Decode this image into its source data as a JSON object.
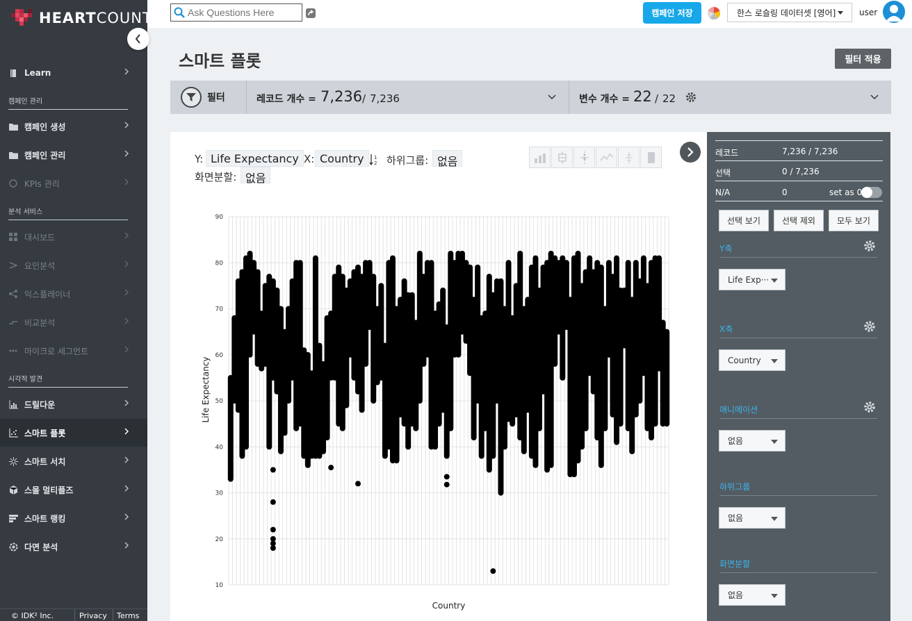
{
  "sidebar": {
    "logo_text_bold": "HEART",
    "logo_text_light": "COUNT",
    "items": [
      {
        "label": "Learn",
        "icon": "book-icon"
      },
      {
        "label": "캠페인 생성",
        "icon": "folder-add-icon"
      },
      {
        "label": "캠페인 관리",
        "icon": "folder-manage-icon"
      },
      {
        "label": "KPIs 관리",
        "icon": "kpi-icon"
      },
      {
        "label": "대시보드",
        "icon": "dashboard-icon"
      },
      {
        "label": "요인분석",
        "icon": "factor-icon"
      },
      {
        "label": "익스플레이너",
        "icon": "share-nodes-icon"
      },
      {
        "label": "비교분석",
        "icon": "compare-icon"
      },
      {
        "label": "마이크로 세그먼트",
        "icon": "segment-icon"
      },
      {
        "label": "드릴다운",
        "icon": "bar-chart-icon"
      },
      {
        "label": "스마트 플롯",
        "icon": "scatter-icon"
      },
      {
        "label": "스마트 서치",
        "icon": "sparkle-icon"
      },
      {
        "label": "스몰 멀티플즈",
        "icon": "cube-icon"
      },
      {
        "label": "스마트 랭킹",
        "icon": "ranking-icon"
      },
      {
        "label": "다면 분석",
        "icon": "gear-icon"
      }
    ],
    "sections": [
      "캠페인 관리",
      "분석 서비스",
      "시각적 발견"
    ],
    "footer": {
      "copyright": "© IDK² Inc.",
      "privacy": "Privacy",
      "terms": "Terms"
    }
  },
  "topbar": {
    "search_placeholder": "Ask Questions Here",
    "save_campaign": "캠페인 저장",
    "dataset": "한스 로슬링 데이터셋 [영어]",
    "user": "user"
  },
  "page": {
    "title": "스마트 플롯",
    "apply_filter": "필터 적용"
  },
  "filterbar": {
    "filter_label": "필터",
    "records_label": "레코드 개수 =",
    "records_value": "7,236",
    "records_total": "7,236",
    "vars_label": "변수 개수 =",
    "vars_value": "22",
    "vars_total": "22"
  },
  "encoding": {
    "y_label": "Y:",
    "y_value": "Life Expectancy",
    "x_label": "X:",
    "x_value": "Country",
    "sort_icon": "sort-ascending-icon",
    "subgroup_label": "하위그룹:",
    "subgroup_value": "없음",
    "split_label": "화면분할:",
    "split_value": "없음"
  },
  "right_panel": {
    "record_label": "레코드",
    "record_value": "7,236 / 7,236",
    "select_label": "선택",
    "select_value": "0 / 7,236",
    "na_label": "N/A",
    "na_value": "0",
    "set_as_zero": "set as 0",
    "btn_view_selected": "선택 보기",
    "btn_exclude_selected": "선택 제외",
    "btn_view_all": "모두 보기",
    "y_axis_head": "Y축",
    "y_axis_value": "Life Exp···",
    "x_axis_head": "X축",
    "x_axis_value": "Country",
    "animation_head": "애니메이션",
    "animation_value": "없음",
    "subgroup_head": "하위그룹",
    "subgroup_value": "없음",
    "split_head": "화면분할",
    "split_value": "없음"
  },
  "colors": {
    "accent": "#16a8e8",
    "sidebar": "#353b40",
    "panel": "#535c63",
    "head": "#3cb4ea"
  },
  "chart_data": {
    "type": "scatter",
    "xlabel": "Country",
    "ylabel": "Life Expectancy",
    "ylim": [
      10,
      90
    ],
    "yticks": [
      10,
      20,
      30,
      40,
      50,
      60,
      70,
      80,
      90
    ],
    "grid": true,
    "x_category_count": 114,
    "note_ranges": "each country column spans min-max life expectancy across years",
    "ranges": [
      [
        33,
        55
      ],
      [
        50,
        68
      ],
      [
        48,
        76
      ],
      [
        38,
        78
      ],
      [
        40,
        81
      ],
      [
        60,
        82
      ],
      [
        65,
        80
      ],
      [
        58,
        78
      ],
      [
        57,
        69
      ],
      [
        58,
        75
      ],
      [
        40,
        77
      ],
      [
        55,
        76
      ],
      [
        52,
        74
      ],
      [
        39,
        70
      ],
      [
        43,
        65
      ],
      [
        50,
        70
      ],
      [
        55,
        76
      ],
      [
        44,
        80
      ],
      [
        45,
        80
      ],
      [
        38,
        61
      ],
      [
        36,
        60
      ],
      [
        38,
        56
      ],
      [
        38,
        81
      ],
      [
        38,
        62
      ],
      [
        39,
        58
      ],
      [
        42,
        68
      ],
      [
        55,
        69
      ],
      [
        55,
        77
      ],
      [
        45,
        79
      ],
      [
        44,
        77
      ],
      [
        49,
        74
      ],
      [
        60,
        76
      ],
      [
        55,
        78
      ],
      [
        52,
        79
      ],
      [
        48,
        77
      ],
      [
        58,
        80
      ],
      [
        66,
        80
      ],
      [
        50,
        77
      ],
      [
        54,
        70
      ],
      [
        55,
        75
      ],
      [
        38,
        62
      ],
      [
        40,
        80
      ],
      [
        37,
        81
      ],
      [
        37,
        70
      ],
      [
        47,
        72
      ],
      [
        45,
        76
      ],
      [
        40,
        73
      ],
      [
        45,
        73
      ],
      [
        44,
        67
      ],
      [
        50,
        82
      ],
      [
        58,
        77
      ],
      [
        60,
        80
      ],
      [
        40,
        80
      ],
      [
        40,
        69
      ],
      [
        45,
        71
      ],
      [
        48,
        74
      ],
      [
        38,
        66
      ],
      [
        44,
        82
      ],
      [
        60,
        80
      ],
      [
        60,
        82
      ],
      [
        65,
        82
      ],
      [
        63,
        80
      ],
      [
        56,
        79
      ],
      [
        42,
        72
      ],
      [
        50,
        79
      ],
      [
        38,
        68
      ],
      [
        44,
        69
      ],
      [
        35,
        77
      ],
      [
        38,
        73
      ],
      [
        50,
        76
      ],
      [
        30,
        76
      ],
      [
        40,
        70
      ],
      [
        46,
        80
      ],
      [
        45,
        68
      ],
      [
        47,
        75
      ],
      [
        42,
        82
      ],
      [
        39,
        70
      ],
      [
        48,
        72
      ],
      [
        38,
        79
      ],
      [
        36,
        81
      ],
      [
        44,
        74
      ],
      [
        52,
        79
      ],
      [
        35,
        80
      ],
      [
        36,
        82
      ],
      [
        58,
        81
      ],
      [
        65,
        80
      ],
      [
        55,
        81
      ],
      [
        66,
        80
      ],
      [
        34,
        72
      ],
      [
        34,
        81
      ],
      [
        37,
        82
      ],
      [
        40,
        75
      ],
      [
        44,
        78
      ],
      [
        56,
        81
      ],
      [
        52,
        78
      ],
      [
        42,
        80
      ],
      [
        36,
        79
      ],
      [
        44,
        70
      ],
      [
        60,
        80
      ],
      [
        47,
        77
      ],
      [
        41,
        81
      ],
      [
        45,
        74
      ],
      [
        62,
        74
      ],
      [
        44,
        80
      ],
      [
        39,
        72
      ],
      [
        47,
        80
      ],
      [
        50,
        76
      ],
      [
        56,
        81
      ],
      [
        44,
        75
      ],
      [
        42,
        80
      ],
      [
        45,
        81
      ],
      [
        57,
        81
      ],
      [
        45,
        67
      ],
      [
        45,
        65
      ]
    ],
    "outliers": [
      {
        "x_index": 11,
        "y": 28
      },
      {
        "x_index": 11,
        "y": 22
      },
      {
        "x_index": 11,
        "y": 20
      },
      {
        "x_index": 11,
        "y": 19
      },
      {
        "x_index": 11,
        "y": 18
      },
      {
        "x_index": 11,
        "y": 35
      },
      {
        "x_index": 26,
        "y": 35.5
      },
      {
        "x_index": 33,
        "y": 32
      },
      {
        "x_index": 56,
        "y": 33.5
      },
      {
        "x_index": 56,
        "y": 31.8
      },
      {
        "x_index": 68,
        "y": 13
      }
    ]
  }
}
